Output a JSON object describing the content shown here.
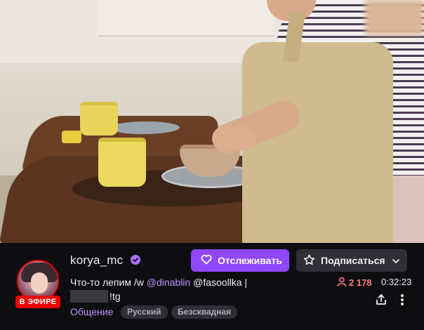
{
  "channel": {
    "name": "korya_mc",
    "live_badge": "В ЭФИРЕ",
    "verified_icon": "verified-check-icon"
  },
  "actions": {
    "follow_label": "Отслеживать",
    "follow_icon": "heart-icon",
    "subscribe_label": "Подписаться",
    "subscribe_icon": "star-icon"
  },
  "stream": {
    "title_prefix": "Что-то лепим /w ",
    "mention1": "@dinablin",
    "title_mid": " @fasoollka |",
    "title_suffix": "!tg",
    "category": "Общение",
    "tags": [
      "Русский",
      "Безсквадная"
    ],
    "viewers": "2 178",
    "uptime": "0:32:23"
  },
  "colors": {
    "accent": "#9147ff",
    "live": "#eb0400",
    "viewer_count": "#ff8280",
    "link": "#bf94ff"
  }
}
